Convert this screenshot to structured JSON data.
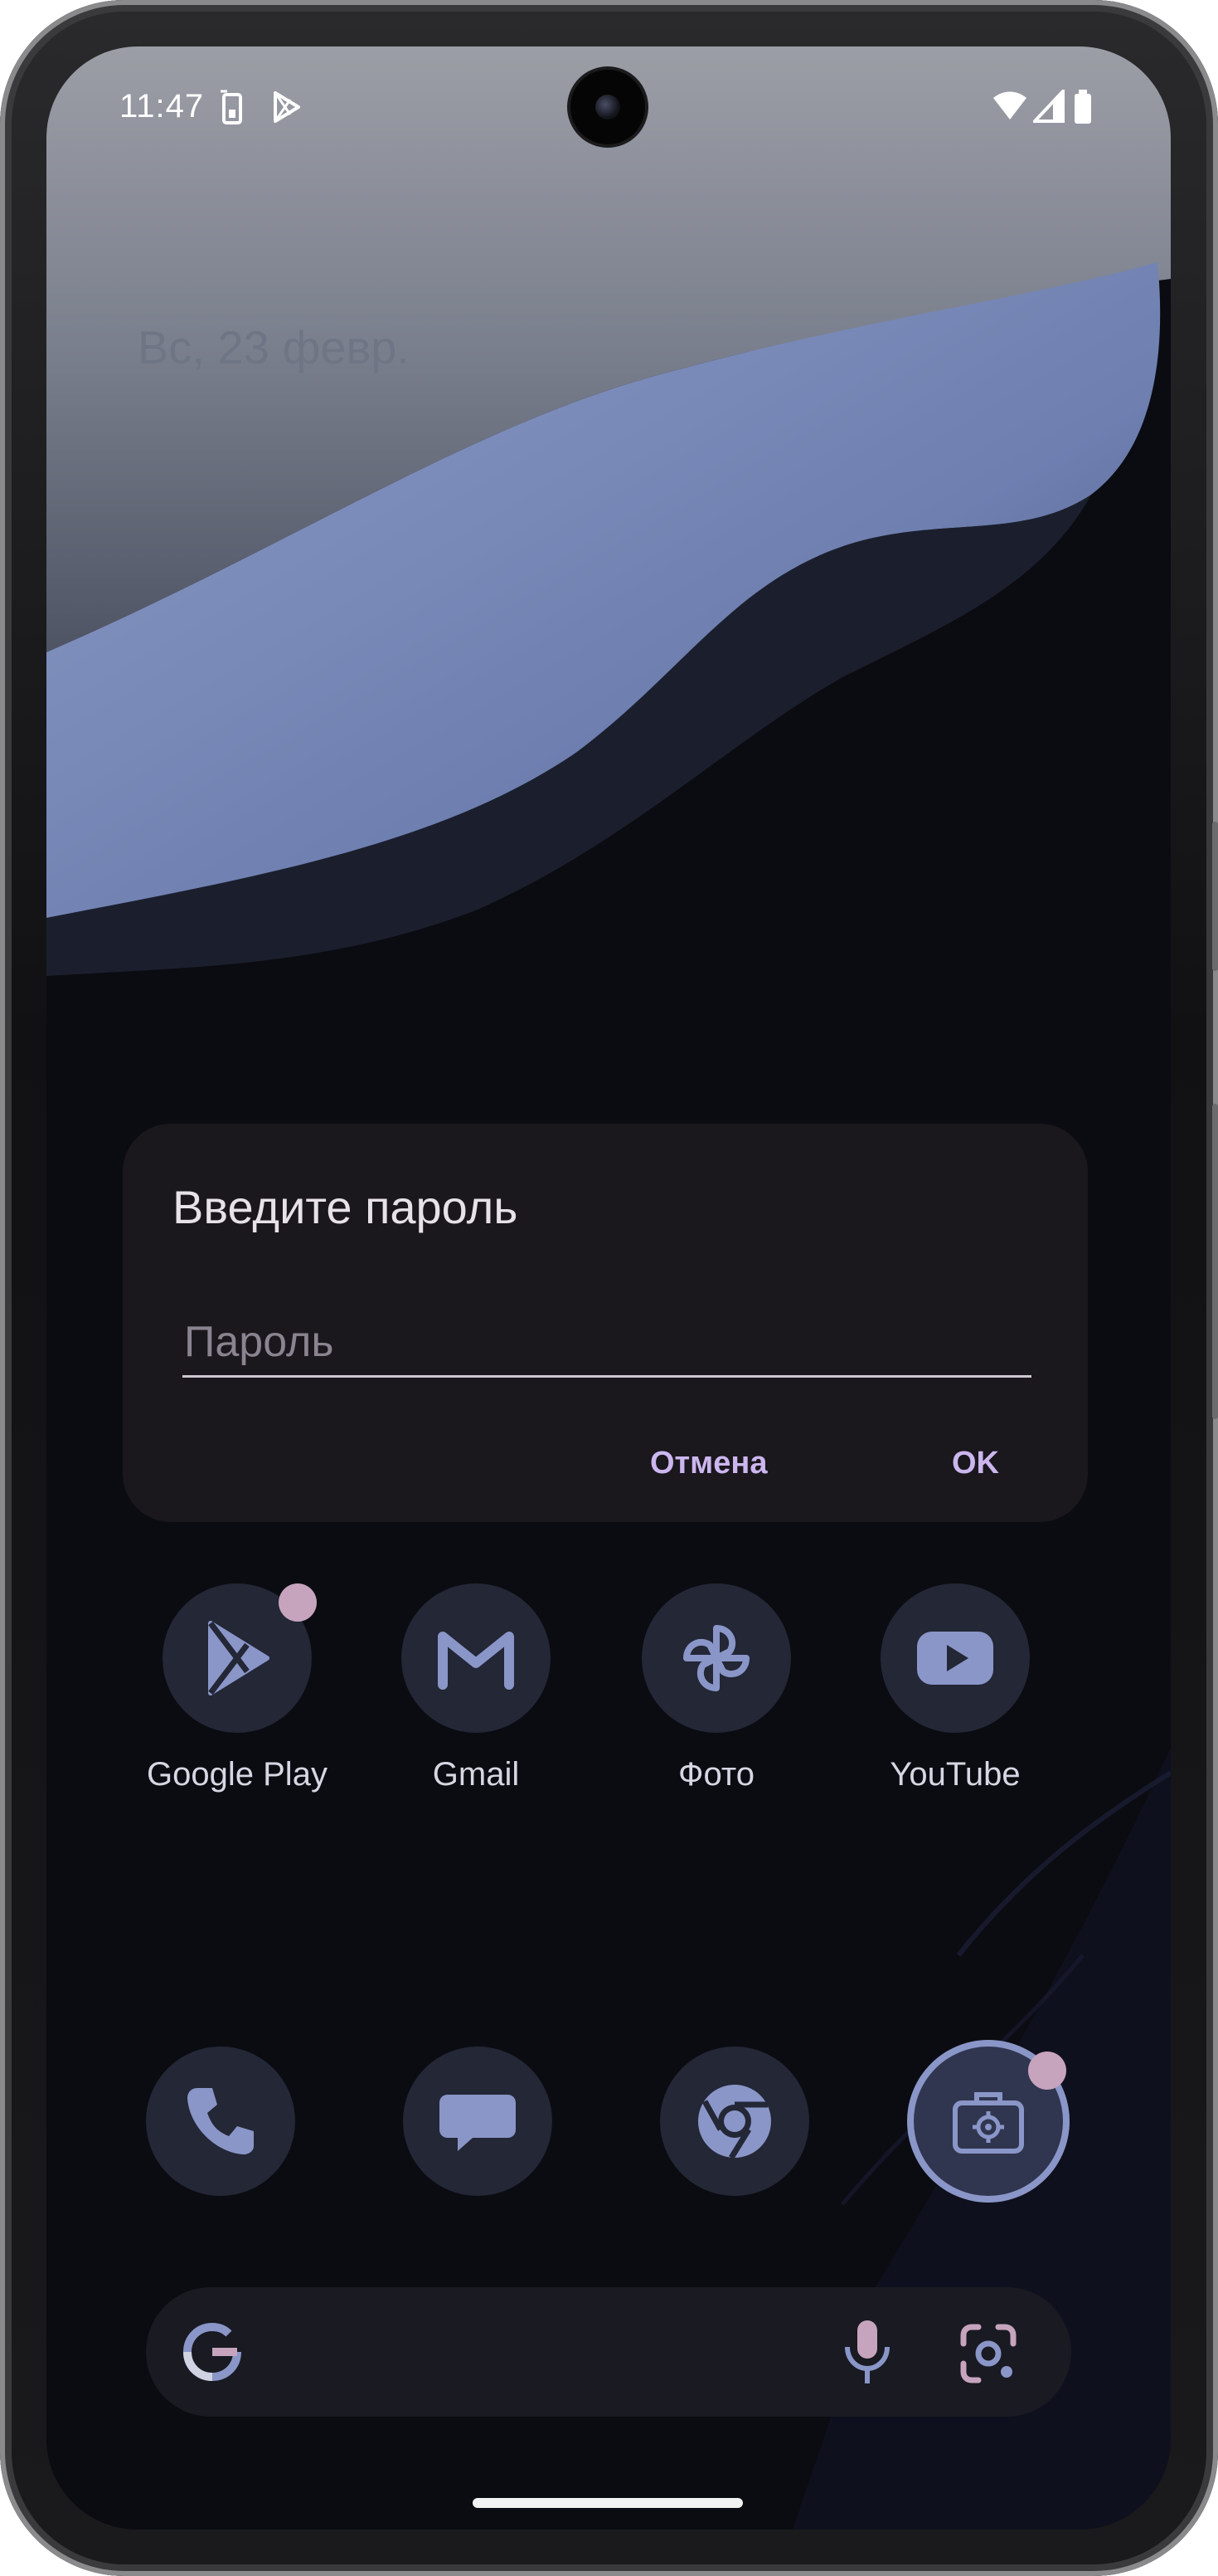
{
  "status_bar": {
    "time": "11:47",
    "left_icons": [
      "phone-sync-icon",
      "play-store-icon"
    ],
    "right_icons": [
      "wifi-icon",
      "cellular-signal-icon",
      "battery-icon"
    ]
  },
  "home": {
    "date": "Вс, 23 февр."
  },
  "dialog": {
    "title": "Введите пароль",
    "password_placeholder": "Пароль",
    "password_value": "",
    "cancel_label": "Отмена",
    "ok_label": "OK"
  },
  "apps_row": [
    {
      "label": "Google Play",
      "icon": "google-play-icon",
      "badge": true
    },
    {
      "label": "Gmail",
      "icon": "gmail-icon",
      "badge": false
    },
    {
      "label": "Фото",
      "icon": "photos-pinwheel-icon",
      "badge": false
    },
    {
      "label": "YouTube",
      "icon": "youtube-icon",
      "badge": false
    }
  ],
  "dock": [
    {
      "icon": "phone-icon",
      "badge": false
    },
    {
      "icon": "messages-icon",
      "badge": false
    },
    {
      "icon": "chrome-icon",
      "badge": false
    },
    {
      "icon": "work-settings-icon",
      "badge": true
    }
  ],
  "search_bar": {
    "icons": [
      "google-g-icon",
      "microphone-icon",
      "google-lens-icon"
    ]
  },
  "colors": {
    "accent_text": "#cbb6ee",
    "badge": "#c7a4bd",
    "icon_tint": "#8a96c8"
  }
}
